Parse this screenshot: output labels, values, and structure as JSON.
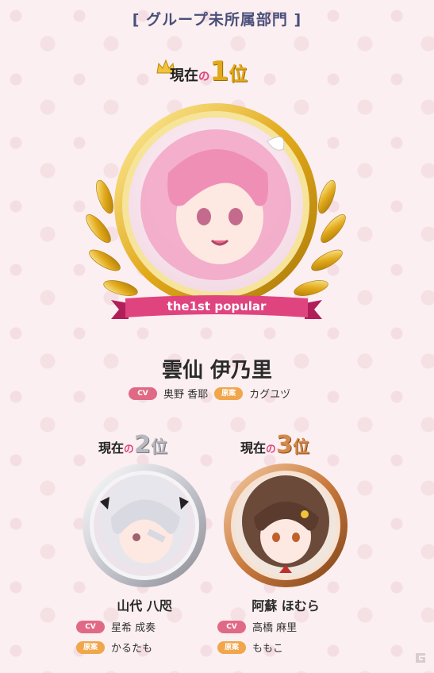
{
  "header": "[ グループ未所属部門 ]",
  "ranks": [
    {
      "prefix": "現在",
      "no": "の",
      "number": "1",
      "suffix": "位",
      "ribbon": "the1st popular",
      "name": "雲仙 伊乃里",
      "cv_tag": "CV",
      "cv": "奥野 香耶",
      "art_tag": "原案",
      "art": "カグユヅ"
    },
    {
      "prefix": "現在",
      "no": "の",
      "number": "2",
      "suffix": "位",
      "name": "山代 八咫",
      "cv_tag": "CV",
      "cv": "星希 成奏",
      "art_tag": "原案",
      "art": "かるたも"
    },
    {
      "prefix": "現在",
      "no": "の",
      "number": "3",
      "suffix": "位",
      "name": "阿蘇 ほむら",
      "cv_tag": "CV",
      "cv": "高橋 麻里",
      "art_tag": "原案",
      "art": "ももこ"
    }
  ],
  "colors": {
    "pink": "#e0447f",
    "gold": "#e2a91a",
    "silver": "#b8b8c0",
    "bronze": "#c97a3e",
    "cv_tag": "#e06a86",
    "art_tag": "#f0a64a"
  },
  "icons": [
    "crown-icon",
    "laurel-wreath-icon",
    "gamer-logo-icon"
  ]
}
